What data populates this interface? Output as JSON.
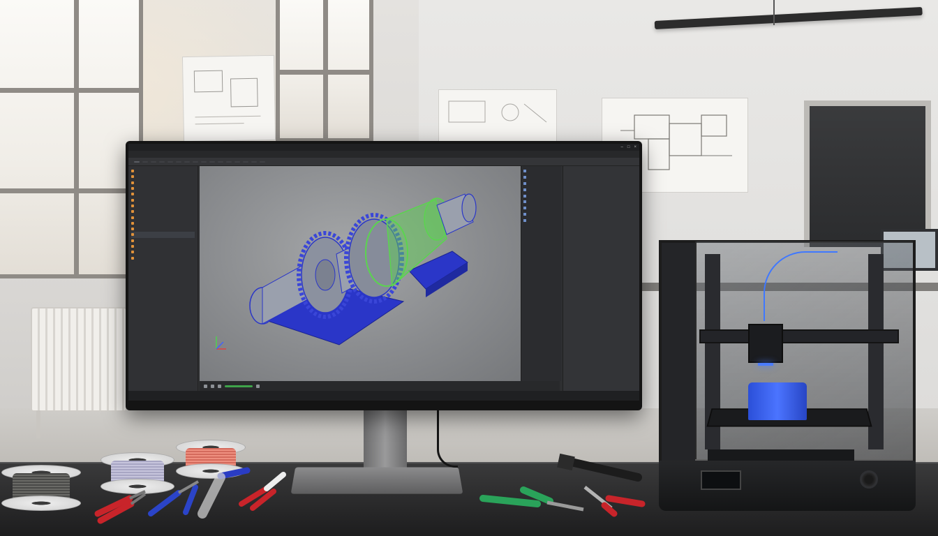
{
  "cad_app": {
    "title": "",
    "menu": [
      "",
      "",
      "",
      "",
      "",
      "",
      "",
      "",
      "",
      "",
      "",
      "",
      "",
      ""
    ],
    "ribbon_tabs": [
      "",
      "",
      "",
      "",
      "",
      "",
      "",
      "",
      "",
      "",
      "",
      "",
      "",
      "",
      "",
      ""
    ],
    "breadcrumb": [
      "",
      "",
      "",
      ""
    ],
    "tree_items": [
      "",
      "",
      "",
      "",
      "",
      "",
      "",
      "",
      "",
      "",
      "",
      "",
      "",
      "",
      "",
      ""
    ],
    "feature_items": [
      "",
      "",
      "",
      "",
      "",
      "",
      "",
      "",
      ""
    ],
    "properties": [
      {
        "key": "",
        "value": ""
      },
      {
        "key": "",
        "value": ""
      },
      {
        "key": "",
        "value": ""
      },
      {
        "key": "",
        "value": ""
      },
      {
        "key": "",
        "value": ""
      },
      {
        "key": "",
        "value": ""
      },
      {
        "key": "",
        "value": ""
      },
      {
        "key": "",
        "value": ""
      },
      {
        "key": "",
        "value": ""
      }
    ],
    "status": [
      "",
      "",
      "",
      ""
    ],
    "status_right": ""
  },
  "colors": {
    "model_gray": "#8f95a3",
    "model_blue": "#2a36c8",
    "model_green": "#5bd44f",
    "accent_orange": "#e1923a",
    "printed_part_blue": "#3b63f0"
  },
  "scene": {
    "objects": [
      "monitor",
      "3d-printer",
      "wire-spools",
      "pliers",
      "wire-strippers",
      "screwdriver",
      "hammer",
      "radiator",
      "window",
      "wall-drawings"
    ]
  }
}
